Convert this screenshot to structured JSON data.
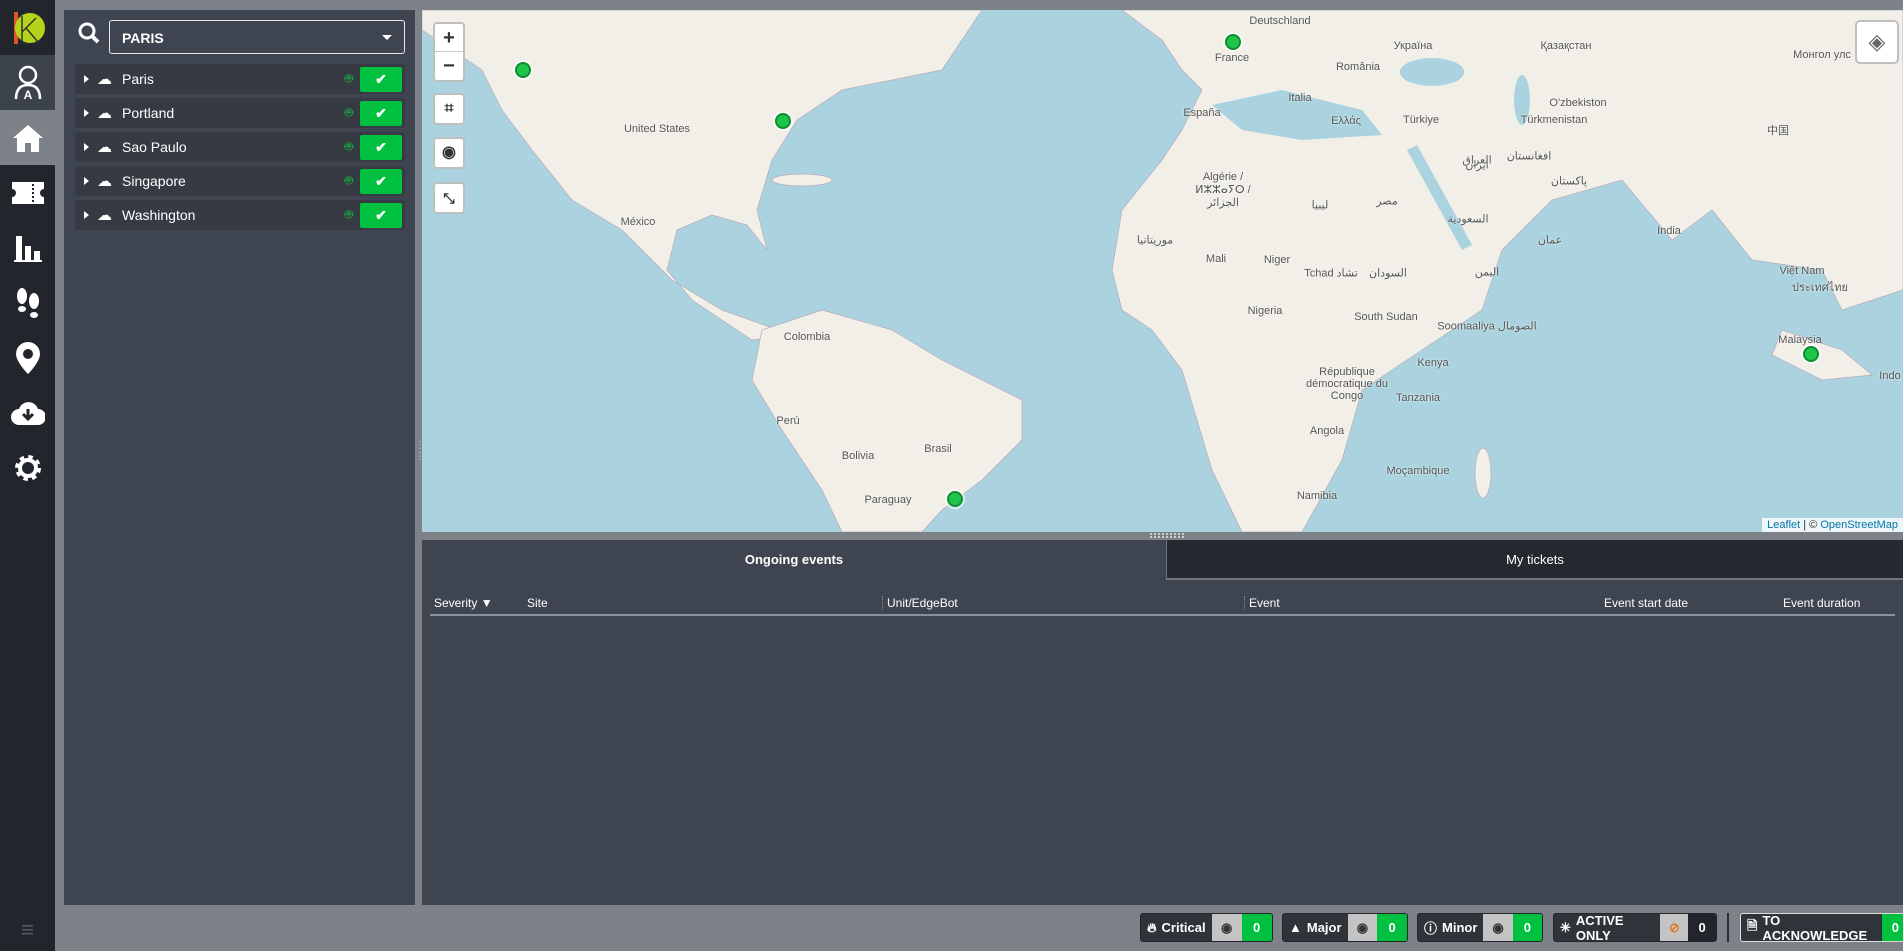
{
  "nav": {
    "items": [
      "user-admin",
      "home",
      "tickets",
      "statistics",
      "footsteps",
      "map-pin",
      "cloud-download",
      "settings"
    ],
    "active": "home"
  },
  "sidebar": {
    "search_value": "PARIS",
    "sites": [
      {
        "label": "Paris",
        "status": "ok"
      },
      {
        "label": "Portland",
        "status": "ok"
      },
      {
        "label": "Sao Paulo",
        "status": "ok"
      },
      {
        "label": "Singapore",
        "status": "ok"
      },
      {
        "label": "Washington",
        "status": "ok"
      }
    ]
  },
  "map": {
    "zoom_in": "+",
    "zoom_out": "−",
    "attribution_leaflet": "Leaflet",
    "attribution_sep": " | © ",
    "attribution_osm": "OpenStreetMap",
    "labels": [
      "Deutschland",
      "France",
      "Україна",
      "România",
      "Italia",
      "España",
      "Ελλάς",
      "Türkiye",
      "Қазақстан",
      "O'zbekiston",
      "Türkmenistan",
      "United States",
      "México",
      "Algérie / ⵍⵣⵣⴰⵢⵔ / الجزائر",
      "Mali",
      "Niger",
      "Tchad تشاد",
      "Nigeria",
      "South Sudan",
      "Kenya",
      "Tanzania",
      "Angola",
      "Namibia",
      "Moçambique",
      "Colombia",
      "Perú",
      "Brasil",
      "Bolivia",
      "Paraguay",
      "India",
      "Việt Nam",
      "Malaysia",
      "République démocratique du Congo",
      "Soomaaliya الصومال",
      "مصر",
      "ليبيا",
      "Indo",
      "中国",
      "السودان",
      "السعودية",
      "ایران",
      "افغانستان",
      "العراق",
      "پاکستان",
      "اليمن",
      "عمان",
      "موريتانيا",
      "ประเทศไทย",
      "Монгол улс"
    ],
    "markers": [
      "Portland",
      "Washington",
      "Paris",
      "Singapore",
      "Sao Paulo"
    ]
  },
  "events": {
    "tabs": [
      {
        "label": "Ongoing events",
        "active": true
      },
      {
        "label": "My tickets",
        "active": false
      }
    ],
    "columns": [
      "Severity",
      "Site",
      "Unit/EdgeBot",
      "Event",
      "Event start date",
      "Event duration"
    ],
    "sort_column": "Severity",
    "rows": []
  },
  "footer": {
    "critical": {
      "label": "Critical",
      "count": "0"
    },
    "major": {
      "label": "Major",
      "count": "0"
    },
    "minor": {
      "label": "Minor",
      "count": "0"
    },
    "active_only": {
      "label": "ACTIVE ONLY",
      "count": "0"
    },
    "to_acknowledge": {
      "label": "TO ACKNOWLEDGE",
      "count": "0"
    }
  },
  "colors": {
    "accent_green": "#00c040",
    "nav_bg": "#22262c",
    "panel_bg": "#3f4550",
    "ocean": "#aad3df",
    "land": "#f2efe9"
  }
}
